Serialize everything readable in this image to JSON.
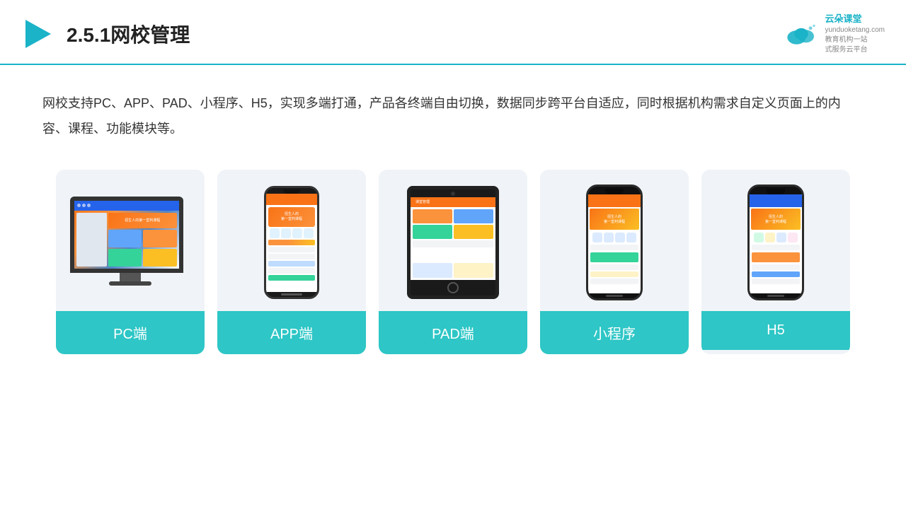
{
  "header": {
    "title": "2.5.1网校管理",
    "logo_brand": "云朵课堂",
    "logo_url": "yunduoketang.com",
    "logo_sub1": "教育机构一站",
    "logo_sub2": "式服务云平台"
  },
  "description": {
    "text": "网校支持PC、APP、PAD、小程序、H5，实现多端打通，产品各终端自由切换，数据同步跨平台自适应，同时根据机构需求自定义页面上的内容、课程、功能模块等。"
  },
  "cards": [
    {
      "id": "pc",
      "label": "PC端"
    },
    {
      "id": "app",
      "label": "APP端"
    },
    {
      "id": "pad",
      "label": "PAD端"
    },
    {
      "id": "mini",
      "label": "小程序"
    },
    {
      "id": "h5",
      "label": "H5"
    }
  ]
}
